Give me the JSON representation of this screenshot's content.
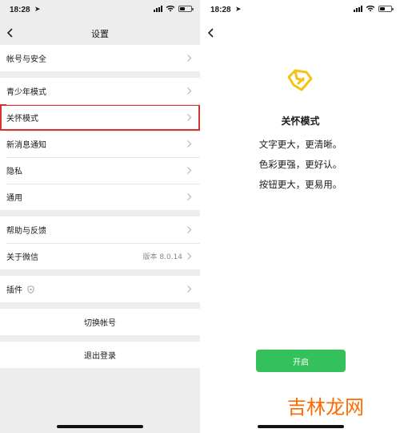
{
  "left_screen": {
    "status": {
      "time": "18:28"
    },
    "nav": {
      "title": "设置"
    },
    "groups": [
      {
        "rows": [
          {
            "label": "帐号与安全"
          }
        ]
      },
      {
        "rows": [
          {
            "label": "青少年模式"
          },
          {
            "label": "关怀模式",
            "highlighted": true
          },
          {
            "label": "新消息通知"
          },
          {
            "label": "隐私"
          },
          {
            "label": "通用"
          }
        ]
      },
      {
        "rows": [
          {
            "label": "帮助与反馈"
          },
          {
            "label": "关于微信",
            "value": "版本 8.0.14"
          }
        ]
      },
      {
        "rows": [
          {
            "label": "插件"
          }
        ]
      }
    ],
    "switch_account": "切换帐号",
    "logout": "退出登录"
  },
  "right_screen": {
    "status": {
      "time": "18:28"
    },
    "title": "关怀模式",
    "lines": [
      "文字更大，更清晰。",
      "色彩更强，更好认。",
      "按钮更大，更易用。"
    ],
    "button": "开启",
    "watermark": "吉林龙网"
  },
  "colors": {
    "accent_green": "#34c15c",
    "highlight_red": "#d6352f",
    "icon_yellow": "#f2c314",
    "watermark_orange": "#ff6a00"
  },
  "icons": [
    "back-chevron-icon",
    "chevron-right-icon",
    "location-arrow-icon",
    "signal-icon",
    "wifi-icon",
    "battery-icon",
    "shield-icon",
    "care-mode-icon"
  ]
}
